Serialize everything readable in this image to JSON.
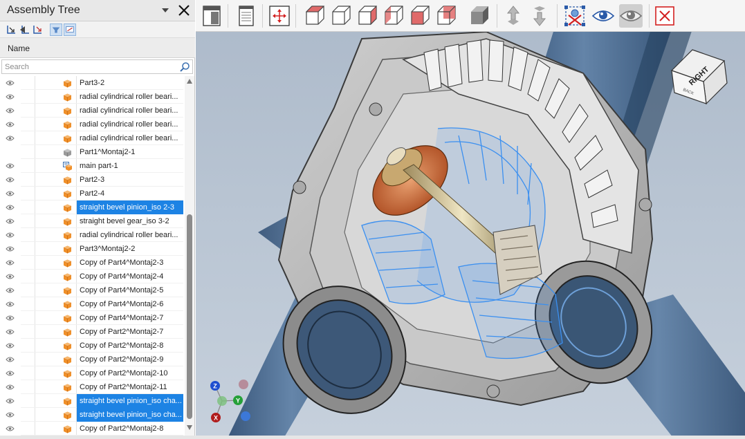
{
  "panel": {
    "title": "Assembly Tree",
    "column_header": "Name",
    "search_placeholder": "Search"
  },
  "tree_rows": [
    {
      "label": "Part3-2",
      "icon": "part-icon",
      "eye": true,
      "selected": false
    },
    {
      "label": "radial cylindrical roller beari...",
      "icon": "part-icon",
      "eye": true,
      "selected": false
    },
    {
      "label": "radial cylindrical roller beari...",
      "icon": "part-icon",
      "eye": true,
      "selected": false
    },
    {
      "label": "radial cylindrical roller beari...",
      "icon": "part-icon",
      "eye": true,
      "selected": false
    },
    {
      "label": "radial cylindrical roller beari...",
      "icon": "part-icon",
      "eye": true,
      "selected": false
    },
    {
      "label": "Part1^Montaj2-1",
      "icon": "hidden-part-icon",
      "eye": false,
      "selected": false
    },
    {
      "label": "main part-1",
      "icon": "assembly-icon",
      "eye": true,
      "selected": false
    },
    {
      "label": "Part2-3",
      "icon": "part-icon",
      "eye": true,
      "selected": false
    },
    {
      "label": "Part2-4",
      "icon": "part-icon",
      "eye": true,
      "selected": false
    },
    {
      "label": "straight bevel pinion_iso 2-3",
      "icon": "part-icon",
      "eye": true,
      "selected": true
    },
    {
      "label": "straight bevel gear_iso 3-2",
      "icon": "part-icon",
      "eye": true,
      "selected": false
    },
    {
      "label": "radial cylindrical roller beari...",
      "icon": "part-icon",
      "eye": true,
      "selected": false
    },
    {
      "label": "Part3^Montaj2-2",
      "icon": "part-icon",
      "eye": true,
      "selected": false
    },
    {
      "label": "Copy of Part4^Montaj2-3",
      "icon": "part-icon",
      "eye": true,
      "selected": false
    },
    {
      "label": "Copy of Part4^Montaj2-4",
      "icon": "part-icon",
      "eye": true,
      "selected": false
    },
    {
      "label": "Copy of Part4^Montaj2-5",
      "icon": "part-icon",
      "eye": true,
      "selected": false
    },
    {
      "label": "Copy of Part4^Montaj2-6",
      "icon": "part-icon",
      "eye": true,
      "selected": false
    },
    {
      "label": "Copy of Part4^Montaj2-7",
      "icon": "part-icon",
      "eye": true,
      "selected": false
    },
    {
      "label": "Copy of Part2^Montaj2-7",
      "icon": "part-icon",
      "eye": true,
      "selected": false
    },
    {
      "label": "Copy of Part2^Montaj2-8",
      "icon": "part-icon",
      "eye": true,
      "selected": false
    },
    {
      "label": "Copy of Part2^Montaj2-9",
      "icon": "part-icon",
      "eye": true,
      "selected": false
    },
    {
      "label": "Copy of Part2^Montaj2-10",
      "icon": "part-icon",
      "eye": true,
      "selected": false
    },
    {
      "label": "Copy of Part2^Montaj2-11",
      "icon": "part-icon",
      "eye": true,
      "selected": false
    },
    {
      "label": "straight bevel pinion_iso cha...",
      "icon": "part-icon",
      "eye": true,
      "selected": true
    },
    {
      "label": "straight bevel pinion_iso cha...",
      "icon": "part-icon",
      "eye": true,
      "selected": true
    },
    {
      "label": "Copy of Part2^Montaj2-8",
      "icon": "part-icon",
      "eye": true,
      "selected": false
    }
  ],
  "toolbar_icons": [
    "sidebar-toggle-icon",
    "document-icon",
    "fit-all-icon",
    "front-view-icon",
    "back-view-icon",
    "left-view-icon",
    "right-view-icon",
    "top-view-icon",
    "bottom-view-icon",
    "shaded-cube-icon",
    "explode-up-icon",
    "explode-down-icon",
    "hide-selected-icon",
    "show-icon",
    "show-all-icon",
    "close-view-icon"
  ],
  "view_cube": {
    "face_label": "RIGHT",
    "side_label": "BACK"
  },
  "triad": {
    "z": "Z",
    "y": "Y",
    "x": "X"
  },
  "colors": {
    "selection": "#1d83e4",
    "part_icon": "#f0902a",
    "viewport_top": "#aebbcb",
    "highlight_blue": "#3a8ff0"
  }
}
